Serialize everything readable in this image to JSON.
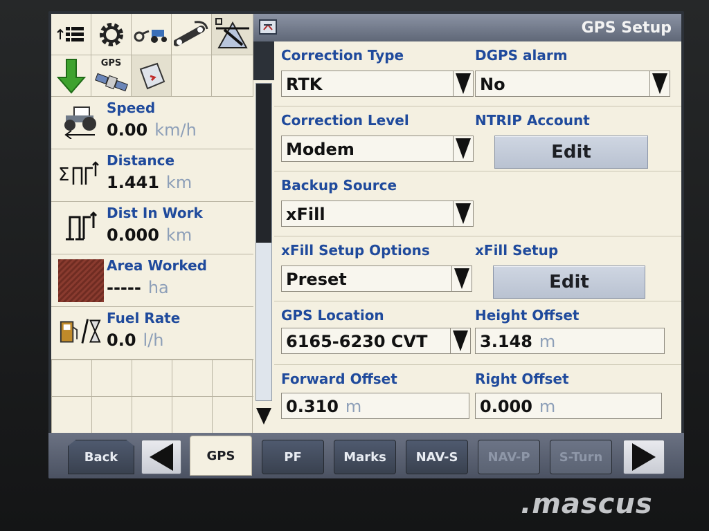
{
  "header": {
    "title": "GPS Setup"
  },
  "toolbar": {
    "gps_label": "GPS"
  },
  "metrics": {
    "speed": {
      "label": "Speed",
      "value": "0.00",
      "unit": "km/h"
    },
    "distance": {
      "label": "Distance",
      "value": "1.441",
      "unit": "km"
    },
    "dist_in_work": {
      "label": "Dist In Work",
      "value": "0.000",
      "unit": "km"
    },
    "area_worked": {
      "label": "Area Worked",
      "value": "-----",
      "unit": "ha"
    },
    "fuel_rate": {
      "label": "Fuel Rate",
      "value": "0.0",
      "unit": "l/h"
    }
  },
  "form": {
    "correction_type": {
      "label": "Correction Type",
      "value": "RTK"
    },
    "dgps_alarm": {
      "label": "DGPS alarm",
      "value": "No"
    },
    "correction_level": {
      "label": "Correction Level",
      "value": "Modem"
    },
    "ntrip_account": {
      "label": "NTRIP Account",
      "button": "Edit"
    },
    "backup_source": {
      "label": "Backup Source",
      "value": "xFill"
    },
    "xfill_options": {
      "label": "xFill Setup Options",
      "value": "Preset"
    },
    "xfill_setup": {
      "label": "xFill Setup",
      "button": "Edit"
    },
    "gps_location": {
      "label": "GPS Location",
      "value": "6165-6230 CVT"
    },
    "height_offset": {
      "label": "Height Offset",
      "value": "3.148",
      "unit": "m"
    },
    "forward_offset": {
      "label": "Forward Offset",
      "value": "0.310",
      "unit": "m"
    },
    "right_offset": {
      "label": "Right Offset",
      "value": "0.000",
      "unit": "m"
    }
  },
  "bottom": {
    "back": "Back",
    "tabs": [
      "GPS",
      "PF",
      "Marks",
      "NAV-S",
      "NAV-P",
      "S-Turn"
    ]
  },
  "watermark": ".mascus",
  "colors": {
    "label_blue": "#1f4a9c",
    "panel_bg": "#f4f0e1",
    "header_grey": "#6b7283",
    "button_dark": "#3f4858"
  }
}
